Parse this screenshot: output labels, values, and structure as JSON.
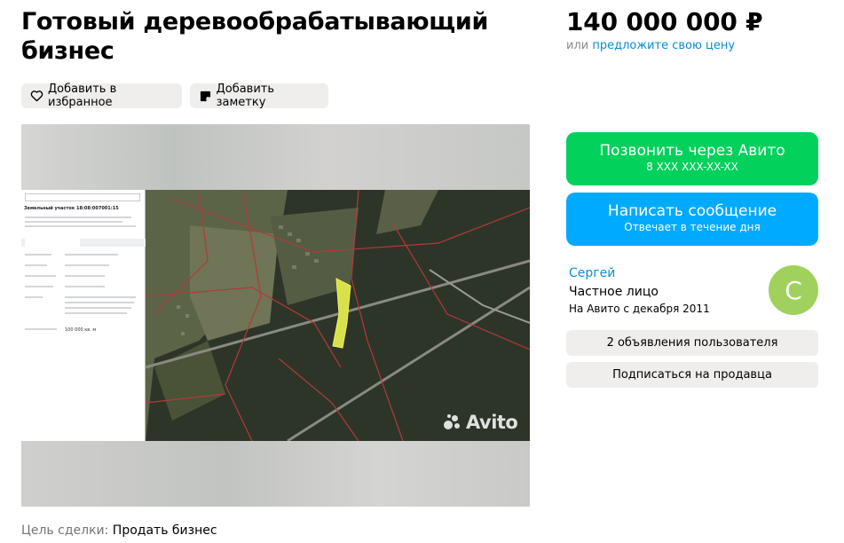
{
  "listing": {
    "title": "Готовый деревообрабатывающий бизнес",
    "price": "140 000 000 ₽",
    "offer_prefix": "или",
    "offer_link": "предложите свою цену",
    "deal_label": "Цель сделки:",
    "deal_value": "Продать бизнес"
  },
  "actions": {
    "favorite": "Добавить в избранное",
    "note": "Добавить заметку"
  },
  "contact": {
    "call_title": "Позвонить через Авито",
    "call_phone": "8 XXX XXX-XX-XX",
    "message_title": "Написать сообщение",
    "message_sub": "Отвечает в течение дня"
  },
  "seller": {
    "name": "Сергей",
    "type": "Частное лицо",
    "since": "На Авито с декабря 2011",
    "avatar_letter": "С",
    "listings_button": "2 объявления пользователя",
    "subscribe_button": "Подписаться на продавца"
  },
  "photo": {
    "watermark": "Avito",
    "panel_heading": "Земельный участок 18:08:007001:15",
    "panel_area": "100 000 кв. м"
  },
  "colors": {
    "call_green": "#02d15c",
    "message_blue": "#00aaff",
    "link_blue": "#0a8cd2",
    "avatar_green": "#9fd15c",
    "button_gray": "#efeeec"
  },
  "icons": {
    "favorite": "heart-icon",
    "note": "note-icon"
  }
}
